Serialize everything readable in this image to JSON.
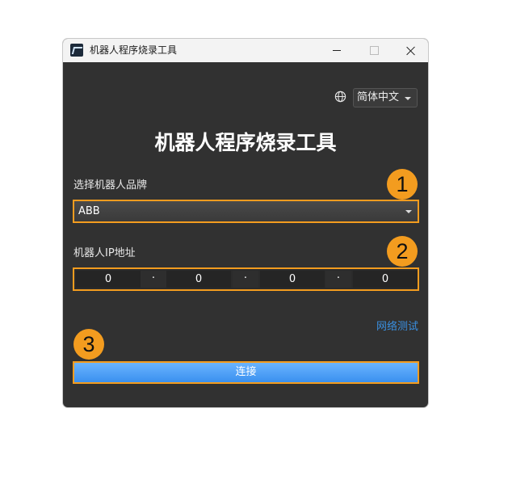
{
  "window": {
    "title": "机器人程序烧录工具"
  },
  "toolbar": {
    "language_icon": "globe-icon",
    "language_selected": "简体中文"
  },
  "main": {
    "heading": "机器人程序烧录工具",
    "brand_label": "选择机器人品牌",
    "brand_selected": "ABB",
    "ip_label": "机器人IP地址",
    "ip_segments": [
      "0",
      "0",
      "0",
      "0"
    ],
    "ip_separator": "·",
    "network_test_link": "网络测试",
    "connect_button": "连接"
  },
  "callouts": [
    "1",
    "2",
    "3"
  ],
  "colors": {
    "background": "#313131",
    "highlight": "#f39c1f",
    "accent_blue": "#3a90ef",
    "link": "#3a8fe0"
  }
}
